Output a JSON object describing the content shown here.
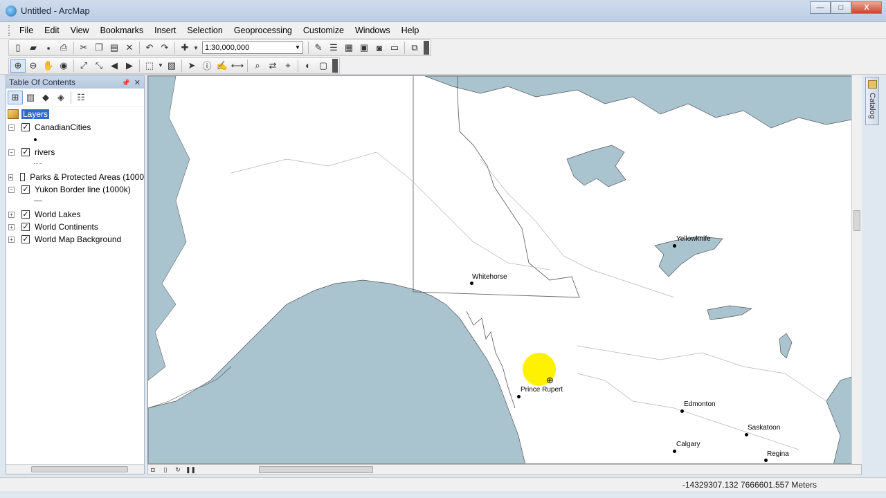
{
  "window": {
    "title": "Untitled - ArcMap",
    "buttons": [
      "—",
      "□",
      "X"
    ]
  },
  "menu": [
    "File",
    "Edit",
    "View",
    "Bookmarks",
    "Insert",
    "Selection",
    "Geoprocessing",
    "Customize",
    "Windows",
    "Help"
  ],
  "toolbar": {
    "scale": "1:30,000,000"
  },
  "toc": {
    "title": "Table Of Contents",
    "root_label": "Layers",
    "layers": [
      {
        "name": "CanadianCities",
        "checked": true,
        "expanded": true
      },
      {
        "name": "rivers",
        "checked": true,
        "expanded": true
      },
      {
        "name": "Parks & Protected Areas (1000",
        "checked": false,
        "expanded": false
      },
      {
        "name": "Yukon Border line (1000k)",
        "checked": true,
        "expanded": true
      },
      {
        "name": "World Lakes",
        "checked": true,
        "expanded": false
      },
      {
        "name": "World Continents",
        "checked": true,
        "expanded": false
      },
      {
        "name": "World Map Background",
        "checked": true,
        "expanded": false
      }
    ]
  },
  "map": {
    "cities": [
      {
        "name": "Whitehorse"
      },
      {
        "name": "Yellowknife"
      },
      {
        "name": "Prince Rupert"
      },
      {
        "name": "Edmonton"
      },
      {
        "name": "Saskatoon"
      },
      {
        "name": "Calgary"
      },
      {
        "name": "Regina"
      }
    ],
    "colors": {
      "water": "#a9c3cf",
      "land": "#ffffff",
      "highlight": "#fff200"
    }
  },
  "catalog_tab": "Catalog",
  "status": {
    "coordinates": "-14329307.132  7666601.557 Meters"
  }
}
